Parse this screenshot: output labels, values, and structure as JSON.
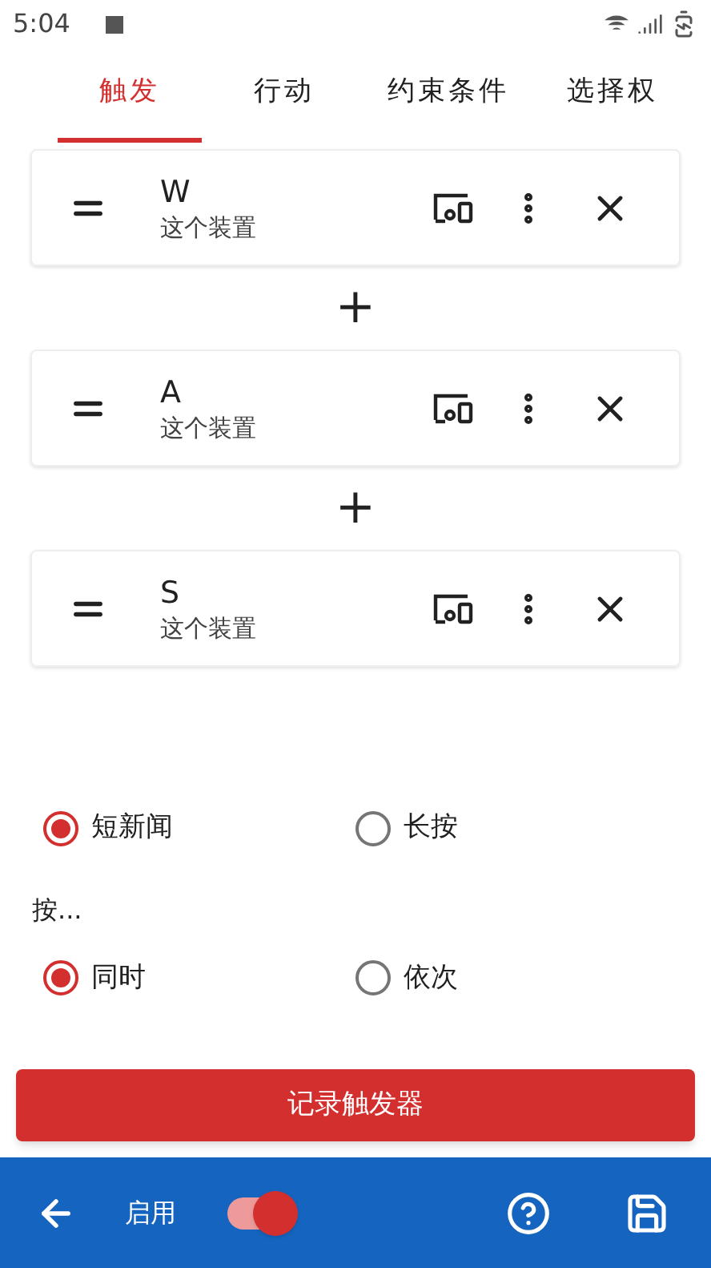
{
  "status_bar": {
    "time": "5:04"
  },
  "tabs": [
    {
      "label": "触发",
      "selected": true
    },
    {
      "label": "行动",
      "selected": false
    },
    {
      "label": "约束条件",
      "selected": false
    },
    {
      "label": "选择权",
      "selected": false
    }
  ],
  "triggers": [
    {
      "key": "W",
      "device": "这个装置"
    },
    {
      "key": "A",
      "device": "这个装置"
    },
    {
      "key": "S",
      "device": "这个装置"
    }
  ],
  "joiner": "+",
  "press_type": [
    {
      "label": "短新闻",
      "selected": true
    },
    {
      "label": "长按",
      "selected": false
    }
  ],
  "press_mode_label": "按...",
  "press_mode": [
    {
      "label": "同时",
      "selected": true
    },
    {
      "label": "依次",
      "selected": false
    }
  ],
  "record_button": "记录触发器",
  "bottom_bar": {
    "enable_label": "启用",
    "enabled": true
  }
}
